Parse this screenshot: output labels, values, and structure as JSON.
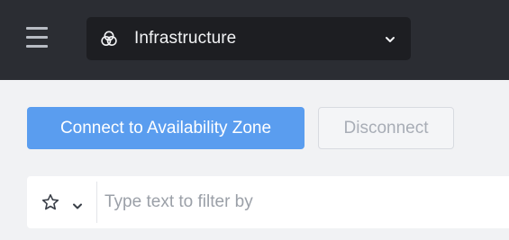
{
  "header": {
    "menu_icon": "hamburger-menu-icon",
    "context_selector": {
      "icon": "infrastructure-circles-icon",
      "label": "Infrastructure",
      "chevron_icon": "chevron-down-icon"
    }
  },
  "actions": {
    "connect_label": "Connect to Availability Zone",
    "disconnect_label": "Disconnect"
  },
  "filter": {
    "favorite_icon": "star-outline-icon",
    "favorite_chevron_icon": "chevron-down-icon",
    "placeholder": "Type text to filter by",
    "value": ""
  },
  "colors": {
    "topbar_bg": "#2b2d33",
    "selector_bg": "#1d1e22",
    "page_bg": "#f1f2f4",
    "primary": "#5a9def",
    "disabled_text": "#a8adb6"
  }
}
